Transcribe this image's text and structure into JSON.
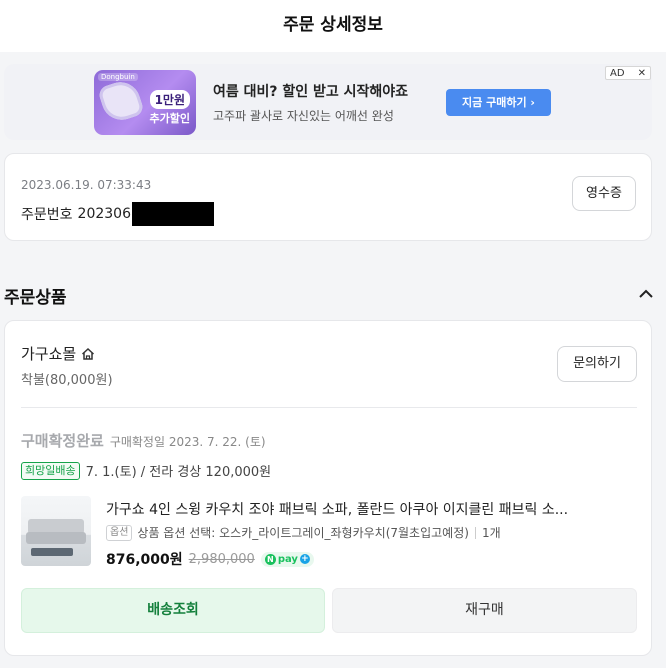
{
  "header": {
    "title": "주문 상세정보"
  },
  "ad": {
    "thumb_tag": "Dongbuin",
    "thumb_promo_line1": "1만원",
    "thumb_promo_line2": "추가할인",
    "title": "여름 대비? 할인 받고 시작해야죠",
    "description": "고주파 괄사로 자신있는 어깨선 완성",
    "cta_label": "지금 구매하기 ›",
    "badge_label": "AD",
    "close_label": "✕",
    "cta_color": "#4a8bf0"
  },
  "order": {
    "date": "2023.06.19. 07:33:43",
    "number_label": "주문번호",
    "number_prefix": "202306",
    "receipt_label": "영수증"
  },
  "products_section": {
    "title": "주문상품",
    "toggle_icon": "chevron-up-icon"
  },
  "seller": {
    "name": "가구쇼몰",
    "home_icon": "home-icon",
    "shipping_fee": "착불(80,000원)",
    "inquiry_label": "문의하기"
  },
  "item": {
    "status": "구매확정완료",
    "confirm_date": "구매확정일 2023. 7. 22. (토)",
    "delivery_badge": "희망일배송",
    "delivery_info": "7. 1.(토) / 전라 경상 120,000원",
    "name": "가구쇼 4인 스윙 카우치 조야 패브릭 소파, 폴란드 아쿠아 이지클린 패브릭 소...",
    "option_tag": "옵션",
    "option_text": "상품 옵션 선택: 오스카_라이트그레이_좌형카우치(7월초입고예정)",
    "quantity": "1개",
    "price": "876,000원",
    "original_price": "2,980,000",
    "npay_n": "N",
    "npay_text": "pay",
    "npay_plus": "+",
    "accent_green": "#16a34a"
  },
  "actions": {
    "track_label": "배송조회",
    "reorder_label": "재구매"
  }
}
